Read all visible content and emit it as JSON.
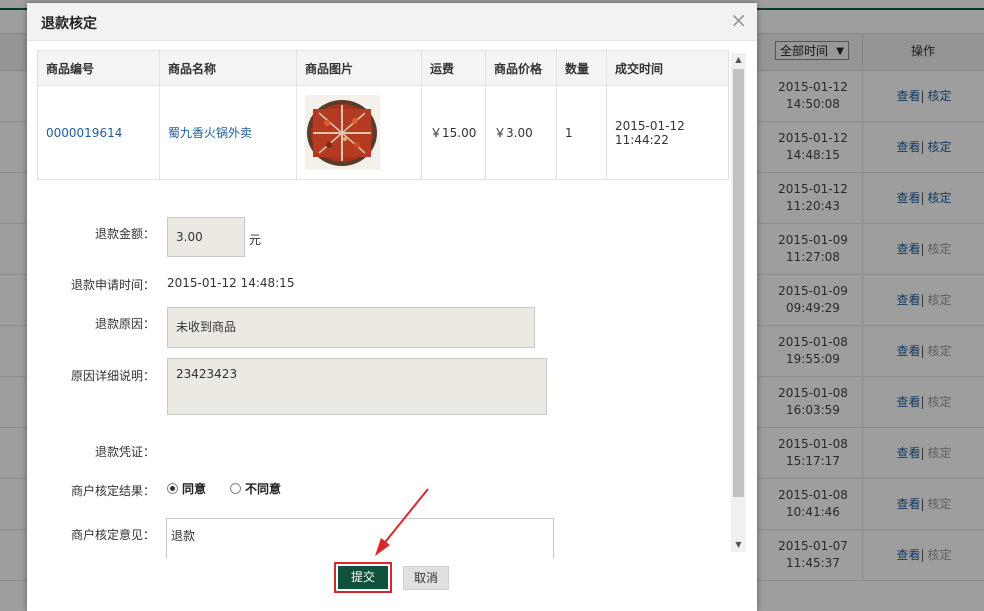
{
  "background": {
    "time_filter": "全部时间",
    "ops_header": "操作",
    "rows": [
      {
        "date": "2015-01-12",
        "time": "14:50:08",
        "view": "查看",
        "sep": "|",
        "verify": "核定",
        "verify_enabled": true
      },
      {
        "date": "2015-01-12",
        "time": "14:48:15",
        "view": "查看",
        "sep": "|",
        "verify": "核定",
        "verify_enabled": true
      },
      {
        "date": "2015-01-12",
        "time": "11:20:43",
        "view": "查看",
        "sep": "|",
        "verify": "核定",
        "verify_enabled": true
      },
      {
        "date": "2015-01-09",
        "time": "11:27:08",
        "view": "查看",
        "sep": "|",
        "verify": "核定",
        "verify_enabled": false
      },
      {
        "date": "2015-01-09",
        "time": "09:49:29",
        "view": "查看",
        "sep": "|",
        "verify": "核定",
        "verify_enabled": false
      },
      {
        "date": "2015-01-08",
        "time": "19:55:09",
        "view": "查看",
        "sep": "|",
        "verify": "核定",
        "verify_enabled": false
      },
      {
        "date": "2015-01-08",
        "time": "16:03:59",
        "view": "查看",
        "sep": "|",
        "verify": "核定",
        "verify_enabled": false
      },
      {
        "date": "2015-01-08",
        "time": "15:17:17",
        "view": "查看",
        "sep": "|",
        "verify": "核定",
        "verify_enabled": false
      },
      {
        "date": "2015-01-08",
        "time": "10:41:46",
        "view": "查看",
        "sep": "|",
        "verify": "核定",
        "verify_enabled": false
      },
      {
        "date": "2015-01-07",
        "time": "11:45:37",
        "view": "查看",
        "sep": "|",
        "verify": "核定",
        "verify_enabled": false
      }
    ]
  },
  "modal": {
    "title": "退款核定",
    "close": "×",
    "table": {
      "headers": [
        "商品编号",
        "商品名称",
        "商品图片",
        "运费",
        "商品价格",
        "数量",
        "成交时间"
      ],
      "row": {
        "id": "0000019614",
        "name": "蜀九香火锅外卖",
        "shipping": "￥15.00",
        "price": "￥3.00",
        "qty": "1",
        "time": "2015-01-12 11:44:22"
      }
    },
    "form": {
      "amount_label": "退款金额：",
      "amount_value": "3.00",
      "amount_unit": "元",
      "apply_time_label": "退款申请时间：",
      "apply_time_value": "2015-01-12 14:48:15",
      "reason_label": "退款原因：",
      "reason_value": "未收到商品",
      "detail_label": "原因详细说明：",
      "detail_value": "23423423",
      "voucher_label": "退款凭证：",
      "result_label": "商户核定结果：",
      "agree": "同意",
      "disagree": "不同意",
      "opinion_label": "商户核定意见：",
      "opinion_value": "退款"
    },
    "buttons": {
      "submit": "提交",
      "cancel": "取消"
    }
  }
}
